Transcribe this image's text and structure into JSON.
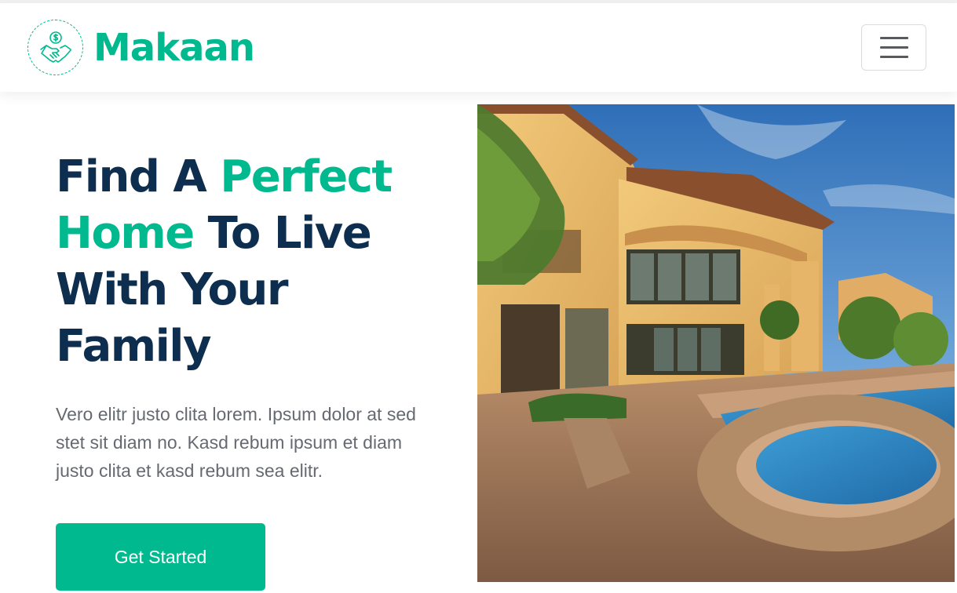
{
  "brand": {
    "name": "Makaan",
    "logo_icon": "handshake-dollar-icon",
    "color": "#00b98e"
  },
  "navbar": {
    "menu_icon": "hamburger-menu-icon"
  },
  "hero": {
    "headline": {
      "part1": "Find A ",
      "accent1": "Perfect",
      "accent2": "Home",
      "part2": " To Live",
      "line3": "With Your",
      "line4": "Family"
    },
    "description": "Vero elitr justo clita lorem. Ipsum dolor at sed stet sit diam no. Kasd rebum ipsum et diam justo clita et kasd rebum sea elitr.",
    "cta_label": "Get Started",
    "image_alt": "luxury-house-with-pool-photo"
  },
  "colors": {
    "primary": "#00b98e",
    "dark": "#0e2e50",
    "text": "#666a70"
  }
}
